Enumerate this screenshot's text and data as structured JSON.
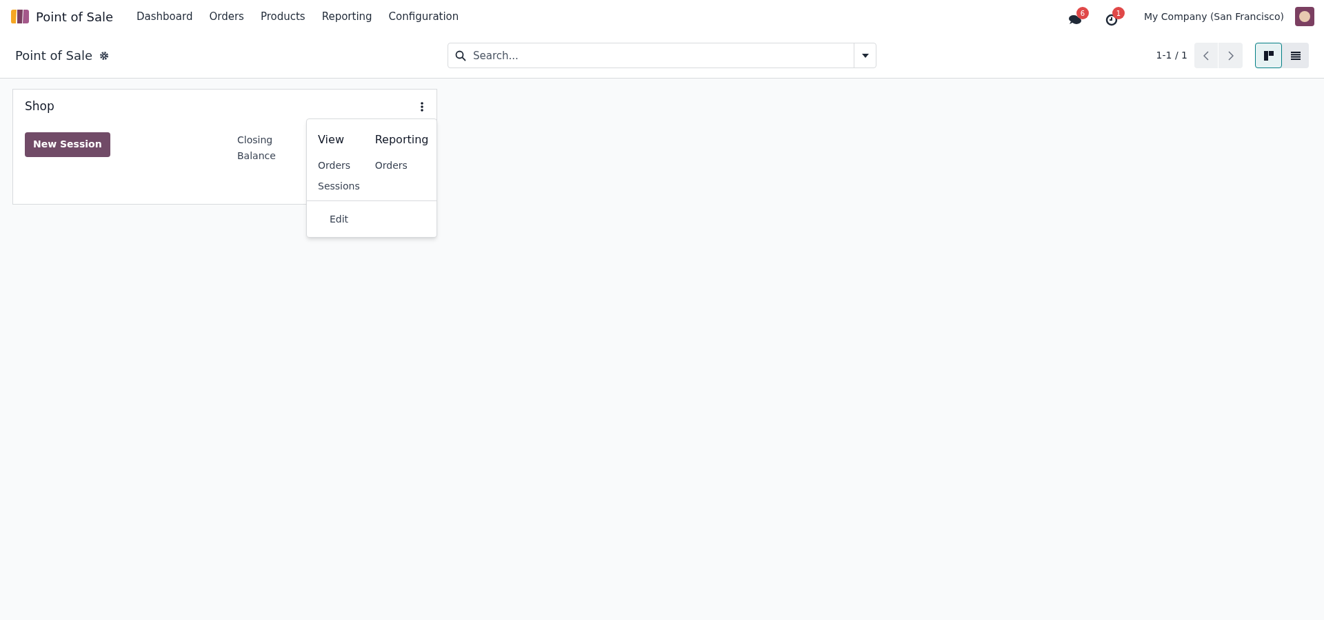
{
  "navbar": {
    "app_name": "Point of Sale",
    "menu": [
      "Dashboard",
      "Orders",
      "Products",
      "Reporting",
      "Configuration"
    ],
    "messages_badge": "6",
    "activities_badge": "1",
    "company": "My Company (San Francisco)"
  },
  "control_panel": {
    "title": "Point of Sale",
    "search": {
      "placeholder": "Search..."
    },
    "pager": "1-1 / 1",
    "views": [
      {
        "kind": "kanban",
        "selected": true
      },
      {
        "kind": "list",
        "selected": false
      }
    ]
  },
  "cards": [
    {
      "title": "Shop",
      "button": "New Session",
      "closing_label": "Closing Balance",
      "menu": {
        "open": true,
        "columns": [
          {
            "heading": "View",
            "items": [
              "Orders",
              "Sessions"
            ]
          },
          {
            "heading": "Reporting",
            "items": [
              "Orders"
            ]
          }
        ],
        "footer": [
          "Edit"
        ]
      }
    }
  ]
}
